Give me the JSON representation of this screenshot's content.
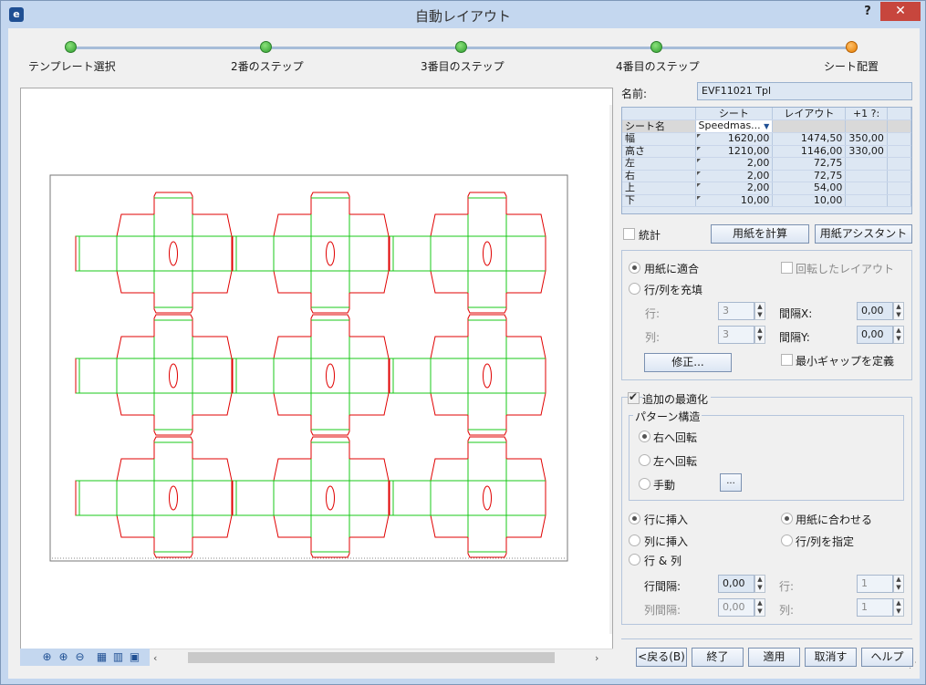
{
  "window": {
    "title": "自動レイアウト",
    "help": "?",
    "close": "✕"
  },
  "wizard": {
    "steps": [
      "テンプレート選択",
      "2番のステップ",
      "3番目のステップ",
      "4番目のステップ",
      "シート配置"
    ]
  },
  "name_label": "名前:",
  "name_value": "EVF11021 Tpl",
  "grid": {
    "headers": [
      "",
      "シート",
      "レイアウト",
      "+1 ?:"
    ],
    "rows": [
      {
        "label": "シート名",
        "sheet": "Speedmas...",
        "layout": "",
        "extra": ""
      },
      {
        "label": "幅",
        "sheet": "1620,00",
        "layout": "1474,50",
        "extra": "350,00"
      },
      {
        "label": "高さ",
        "sheet": "1210,00",
        "layout": "1146,00",
        "extra": "330,00"
      },
      {
        "label": "左",
        "sheet": "2,00",
        "layout": "72,75",
        "extra": ""
      },
      {
        "label": "右",
        "sheet": "2,00",
        "layout": "72,75",
        "extra": ""
      },
      {
        "label": "上",
        "sheet": "2,00",
        "layout": "54,00",
        "extra": ""
      },
      {
        "label": "下",
        "sheet": "10,00",
        "layout": "10,00",
        "extra": ""
      }
    ]
  },
  "stats_label": "統計",
  "calc_button": "用紙を計算",
  "assistant_button": "用紙アシスタント",
  "fit": {
    "fit_paper": "用紙に適合",
    "rotated_layout": "回転したレイアウト",
    "fill_rows_cols": "行/列を充填",
    "row_label": "行:",
    "row_value": "3",
    "col_label": "列:",
    "col_value": "3",
    "gap_x_label": "間隔X:",
    "gap_x_value": "0,00",
    "gap_y_label": "間隔Y:",
    "gap_y_value": "0,00",
    "modify_button": "修正...",
    "min_gap": "最小ギャップを定義"
  },
  "optimize": {
    "title": "追加の最適化",
    "pattern_title": "パターン構造",
    "rotate_right": "右へ回転",
    "rotate_left": "左へ回転",
    "manual": "手動",
    "manual_button": "...",
    "insert_row": "行に挿入",
    "insert_col": "列に挿入",
    "row_col": "行 & 列",
    "fit_to_paper": "用紙に合わせる",
    "specify_rows_cols": "行/列を指定",
    "row_gap_label": "行間隔:",
    "row_gap_value": "0,00",
    "col_gap_label": "列間隔:",
    "col_gap_value": "0,00",
    "row_label": "行:",
    "row_value": "1",
    "col_label": "列:",
    "col_value": "1"
  },
  "footer": {
    "back": "<戻る(B)",
    "finish": "終了",
    "apply": "適用",
    "cancel": "取消す",
    "help": "ヘルプ"
  },
  "layout_preview": {
    "rows": 3,
    "cols": 3
  },
  "colors": {
    "cut": "#e00000",
    "crease": "#19c819",
    "accent": "#c4d7ef"
  }
}
